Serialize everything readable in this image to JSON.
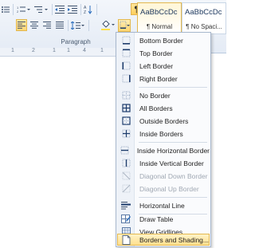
{
  "ribbon": {
    "group_label": "Paragraph",
    "show_hide_symbol": "¶",
    "styles": [
      {
        "sample": "AaBbCcDc",
        "name": "¶ Normal",
        "active": true
      },
      {
        "sample": "AaBbCcDc",
        "name": "¶ No Spaci...",
        "active": false
      }
    ]
  },
  "ruler": {
    "marks": [
      "1",
      "2",
      "1",
      "1",
      "4",
      "1"
    ]
  },
  "borders_menu": {
    "items": [
      {
        "icon": "bottom-border-icon",
        "label": "Bottom Border",
        "disabled": false
      },
      {
        "icon": "top-border-icon",
        "label": "Top Border",
        "disabled": false
      },
      {
        "icon": "left-border-icon",
        "label": "Left Border",
        "disabled": false
      },
      {
        "icon": "right-border-icon",
        "label": "Right Border",
        "disabled": false
      },
      {
        "icon": "no-border-icon",
        "label": "No Border",
        "disabled": false
      },
      {
        "icon": "all-borders-icon",
        "label": "All Borders",
        "disabled": false
      },
      {
        "icon": "outside-borders-icon",
        "label": "Outside Borders",
        "disabled": false
      },
      {
        "icon": "inside-borders-icon",
        "label": "Inside Borders",
        "disabled": false
      },
      {
        "icon": "inside-horizontal-border-icon",
        "label": "Inside Horizontal Border",
        "disabled": false
      },
      {
        "icon": "inside-vertical-border-icon",
        "label": "Inside Vertical Border",
        "disabled": false
      },
      {
        "icon": "diagonal-down-border-icon",
        "label": "Diagonal Down Border",
        "disabled": true
      },
      {
        "icon": "diagonal-up-border-icon",
        "label": "Diagonal Up Border",
        "disabled": true
      },
      {
        "icon": "horizontal-line-icon",
        "label": "Horizontal Line",
        "disabled": false
      },
      {
        "icon": "draw-table-icon",
        "label": "Draw Table",
        "disabled": false
      },
      {
        "icon": "view-gridlines-icon",
        "label": "View Gridlines",
        "disabled": false
      },
      {
        "icon": "borders-and-shading-icon",
        "label": "Borders and Shading...",
        "disabled": false,
        "highlighted": true
      }
    ]
  },
  "colors": {
    "accent_highlight": "#ffe08e",
    "menu_border": "#a7b7cd",
    "ribbon_bg": "#e4ebf5"
  }
}
